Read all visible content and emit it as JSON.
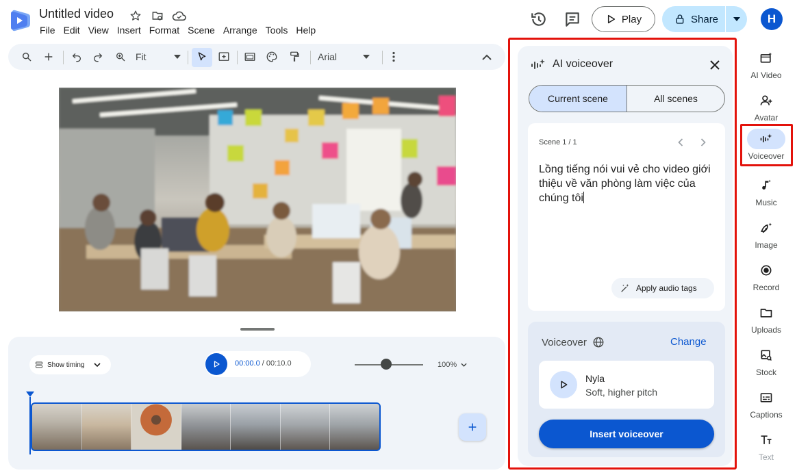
{
  "header": {
    "doc_title": "Untitled video",
    "menu": [
      "File",
      "Edit",
      "View",
      "Insert",
      "Format",
      "Scene",
      "Arrange",
      "Tools",
      "Help"
    ],
    "play_label": "Play",
    "share_label": "Share",
    "avatar_initial": "H"
  },
  "toolbar": {
    "zoom_label": "Fit",
    "font_label": "Arial"
  },
  "timeline": {
    "show_timing_label": "Show timing",
    "current_time": "00:00.0",
    "separator": " / ",
    "total_time": "00:10.0",
    "zoom_pct": "100%"
  },
  "panel": {
    "title": "AI voiceover",
    "tabs": [
      "Current scene",
      "All scenes"
    ],
    "scene_counter": "Scene 1 / 1",
    "script_text": "Lồng tiếng nói vui vẻ cho video giới thiệu về văn phòng làm việc của chúng tôi",
    "apply_tags_label": "Apply audio tags",
    "voiceover_label": "Voiceover",
    "change_label": "Change",
    "voice_name": "Nyla",
    "voice_desc": "Soft, higher pitch",
    "insert_label": "Insert voiceover"
  },
  "rail": [
    {
      "label": "AI Video",
      "icon": "ai-video-icon"
    },
    {
      "label": "Avatar",
      "icon": "avatar-icon"
    },
    {
      "label": "Voiceover",
      "icon": "voiceover-icon"
    },
    {
      "label": "Music",
      "icon": "music-icon"
    },
    {
      "label": "Image",
      "icon": "image-icon"
    },
    {
      "label": "Record",
      "icon": "record-icon"
    },
    {
      "label": "Uploads",
      "icon": "uploads-icon"
    },
    {
      "label": "Stock",
      "icon": "stock-icon"
    },
    {
      "label": "Captions",
      "icon": "captions-icon"
    },
    {
      "label": "Text",
      "icon": "text-icon"
    }
  ],
  "colors": {
    "accent": "#0b57d0",
    "accent_light": "#d3e3fd",
    "highlight_box": "#e3120b",
    "surface": "#f0f4f9"
  }
}
